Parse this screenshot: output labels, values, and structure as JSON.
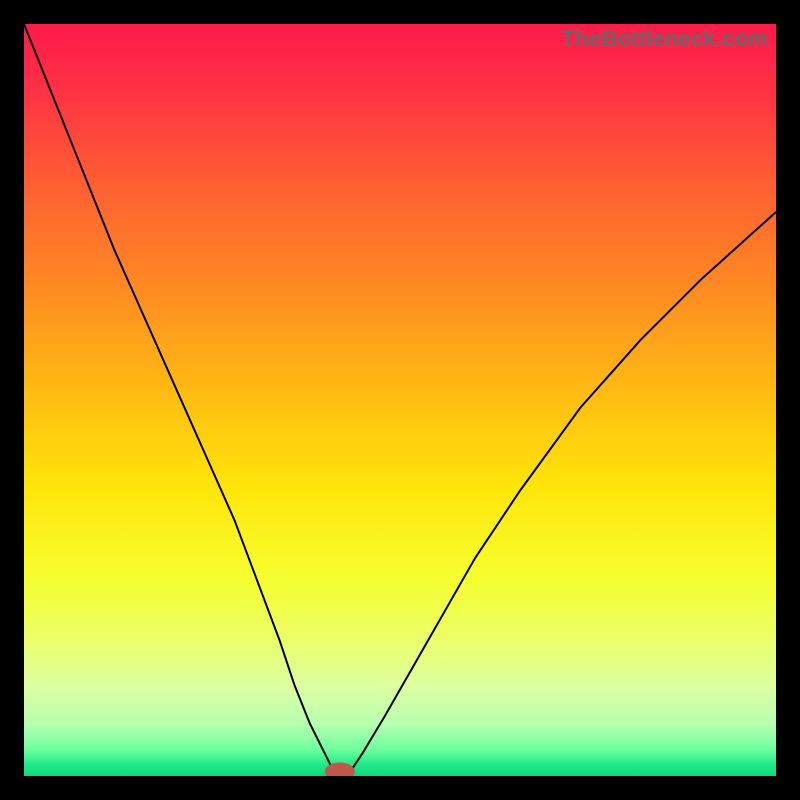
{
  "watermark": "TheBottleneck.com",
  "chart_data": {
    "type": "line",
    "title": "",
    "xlabel": "",
    "ylabel": "",
    "xlim": [
      0,
      100
    ],
    "ylim": [
      0,
      100
    ],
    "legend": false,
    "grid": false,
    "background_gradient": [
      {
        "offset": 0.0,
        "color": "#ff1a4b"
      },
      {
        "offset": 0.08,
        "color": "#ff2f45"
      },
      {
        "offset": 0.2,
        "color": "#ff5a34"
      },
      {
        "offset": 0.35,
        "color": "#ff8a22"
      },
      {
        "offset": 0.5,
        "color": "#ffbf12"
      },
      {
        "offset": 0.62,
        "color": "#ffe60a"
      },
      {
        "offset": 0.74,
        "color": "#f6ff30"
      },
      {
        "offset": 0.82,
        "color": "#eaff6a"
      },
      {
        "offset": 0.88,
        "color": "#dcffa0"
      },
      {
        "offset": 0.93,
        "color": "#b8ffb0"
      },
      {
        "offset": 0.965,
        "color": "#6dff9d"
      },
      {
        "offset": 0.985,
        "color": "#20e98a"
      },
      {
        "offset": 1.0,
        "color": "#0fd879"
      }
    ],
    "series": [
      {
        "name": "bottleneck-curve",
        "color": "#000000",
        "x": [
          0,
          4,
          8,
          12,
          16,
          20,
          24,
          28,
          31,
          34,
          36,
          38,
          40,
          41,
          42,
          43,
          45,
          48,
          52,
          56,
          60,
          66,
          74,
          82,
          90,
          100
        ],
        "y": [
          100,
          90,
          80,
          70,
          61,
          52,
          43,
          34,
          26,
          18,
          12,
          7,
          3,
          1,
          0,
          0,
          3,
          8,
          15,
          22,
          29,
          38,
          49,
          58,
          66,
          75
        ]
      }
    ],
    "marker": {
      "name": "optimal-point",
      "x": 42,
      "y": 0,
      "rx": 2.0,
      "ry": 1.2,
      "color": "#c0574b"
    }
  }
}
